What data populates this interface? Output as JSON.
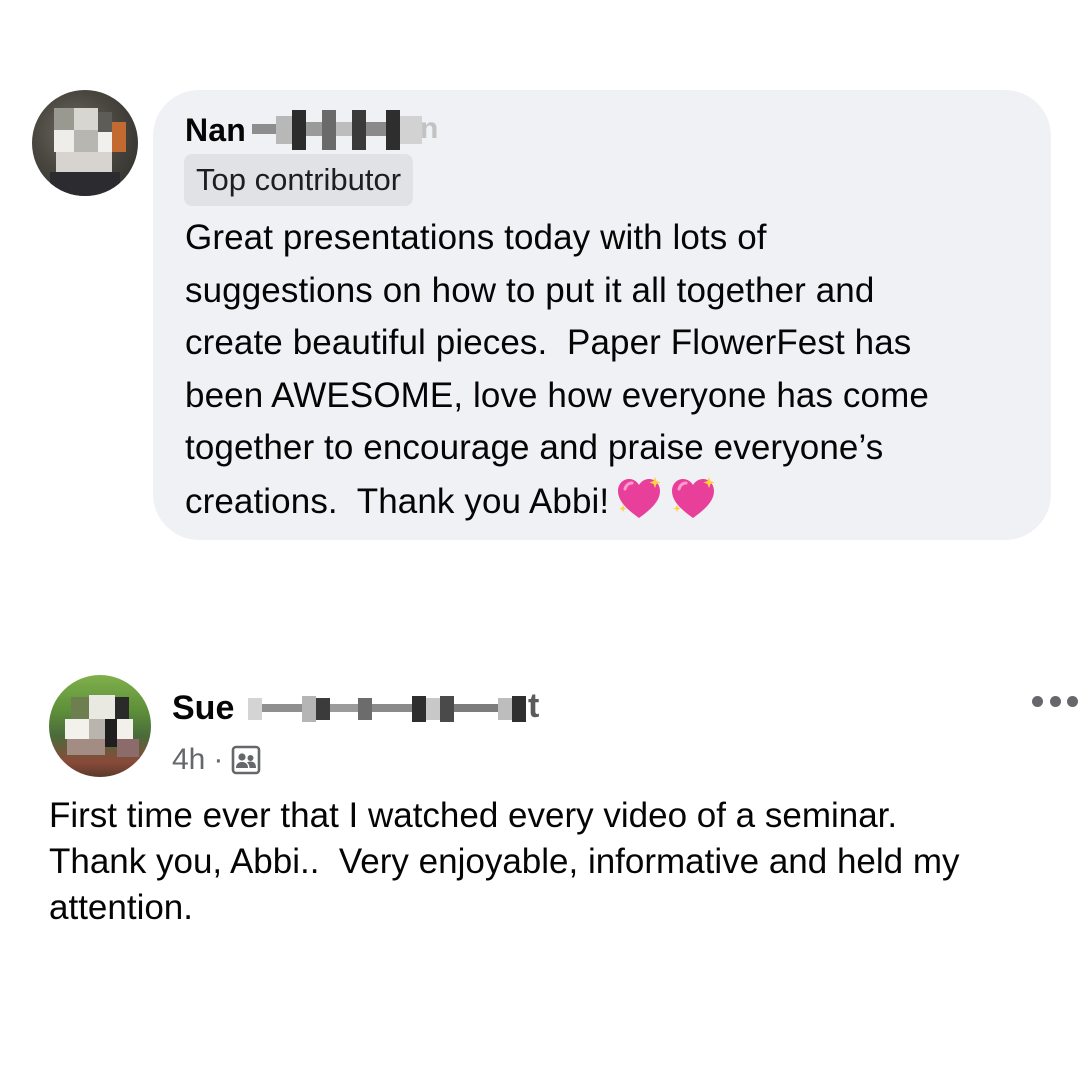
{
  "comments": [
    {
      "author_visible": "Nan",
      "author_trailing_visible": "n",
      "badge": "Top contributor",
      "body_lines": [
        "Great presentations today with lots of",
        "suggestions on how to put it all together and",
        "create beautiful pieces.  Paper FlowerFest has",
        "been AWESOME, love how everyone has come",
        "together to encourage and praise everyone’s",
        "creations.  Thank you Abbi!"
      ],
      "emoji": [
        "sparkling-heart",
        "sparkling-heart"
      ]
    },
    {
      "author_visible": "Sue",
      "author_trailing_visible": "t",
      "timestamp": "4h",
      "separator": "·",
      "audience_icon": "group-members-icon",
      "more_icon": "more-horizontal-icon",
      "body_lines": [
        "First time ever that I watched every video of a seminar.",
        "Thank you, Abbi..  Very enjoyable, informative and held my",
        "attention."
      ]
    }
  ],
  "colors": {
    "bubble": "#eff1f4",
    "badge": "#e0e2e6",
    "text": "#050505",
    "secondary": "#65676b",
    "heart": "#e8409a"
  }
}
